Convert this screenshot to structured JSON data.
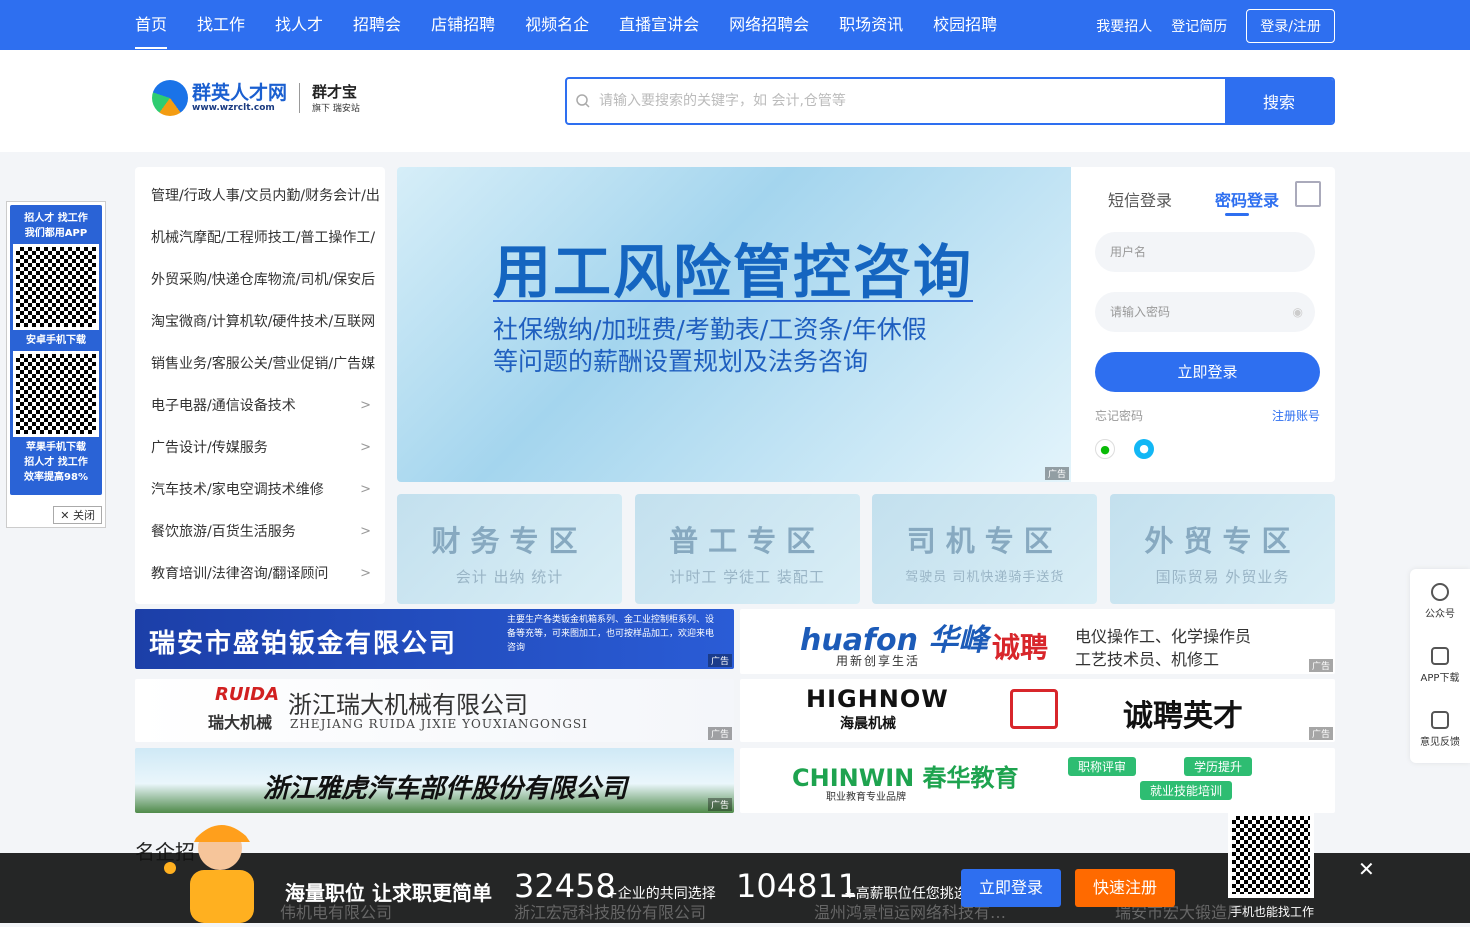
{
  "nav": {
    "items": [
      "首页",
      "找工作",
      "找人才",
      "招聘会",
      "店铺招聘",
      "视频名企",
      "直播宣讲会",
      "网络招聘会",
      "职场资讯",
      "校园招聘"
    ],
    "right": [
      "我要招人",
      "登记简历"
    ],
    "login": "登录/注册"
  },
  "logo": {
    "name": "群英人才网",
    "url": "www.wzrclt.com",
    "brand": "群才宝",
    "brand_sub": "旗下 瑞安站"
  },
  "search": {
    "placeholder": "请输入要搜索的关键字，如 会计,仓管等",
    "button": "搜索"
  },
  "float_ad": {
    "top": "招人才 找工作\n我们都用APP",
    "android": "安卓手机下载",
    "ios": "苹果手机下载",
    "bottom1": "招人才 找工作",
    "bottom2": "效率提高98%",
    "close": "关闭"
  },
  "categories": [
    "管理/行政人事/文员内勤/财务会计/出",
    "机械汽摩配/工程师技工/普工操作工/",
    "外贸采购/快递仓库物流/司机/保安后",
    "淘宝微商/计算机软/硬件技术/互联网",
    "销售业务/客服公关/营业促销/广告媒",
    "电子电器/通信设备技术",
    "广告设计/传媒服务",
    "汽车技术/家电空调技术维修",
    "餐饮旅游/百货生活服务",
    "教育培训/法律咨询/翻译顾问"
  ],
  "banner": {
    "headline": "用工风险管控咨询",
    "line1": "社保缴纳/加班费/考勤表/工资条/年休假",
    "line2": "等问题的薪酬设置规划及法务咨询",
    "tag": "广告"
  },
  "login": {
    "tab_sms": "短信登录",
    "tab_pwd": "密码登录",
    "username": "用户名",
    "password": "请输入密码",
    "button": "立即登录",
    "forgot": "忘记密码",
    "register": "注册账号"
  },
  "zones": [
    {
      "title": "财务专区",
      "sub": "会计  出纳  统计"
    },
    {
      "title": "普工专区",
      "sub": "计时工  学徒工  装配工"
    },
    {
      "title": "司机专区",
      "sub": "驾驶员  司机快递骑手送货"
    },
    {
      "title": "外贸专区",
      "sub": "国际贸易  外贸业务"
    }
  ],
  "ads": {
    "a1": "瑞安市盛铂钣金有限公司",
    "a1_sub": "主要生产各类钣金机箱系列、金工业控制柜系列、设备等充等，可来图加工，也可按样品加工，欢迎来电咨询",
    "a2_brand": "huafon 华峰",
    "a2_tag": "用新创享生活",
    "a2_hire": "诚聘",
    "a2_jobs1": "电仪操作工、化学操作员",
    "a2_jobs2": "工艺技术员、机修工",
    "a3_logo": "RUIDA",
    "a3_logo_cn": "瑞大机械",
    "a3_name": "浙江瑞大机械有限公司",
    "a3_py": "ZHEJIANG RUIDA JIXIE YOUXIANGONGSI",
    "a4_brand": "HIGHNOW",
    "a4_cn": "海晨机械",
    "a4_hire": "诚聘英才",
    "a5": "浙江雅虎汽车部件股份有限公司",
    "a6_brand": "CHINWIN 春华教育",
    "a6_sub": "职业教育专业品牌",
    "a6_p1": "职称评审",
    "a6_p2": "学历提升",
    "a6_p3": "就业技能培训",
    "tag": "广告"
  },
  "section_title": "名企招",
  "companies": [
    "伟机电有限公司",
    "浙江宏冠科技股份有限公司",
    "温州鸿景恒运网络科技有…",
    "瑞安市宏大锻造厂"
  ],
  "sidebar": [
    "公众号",
    "APP下载",
    "意见反馈"
  ],
  "bottom": {
    "slogan": "海量职位 让求职更简单",
    "n1": "32458",
    "l1": "+企业的共同选择",
    "n2": "104811",
    "l2": "+高薪职位任您挑选",
    "login": "立即登录",
    "register": "快速注册",
    "qr_label": "手机也能找工作"
  }
}
